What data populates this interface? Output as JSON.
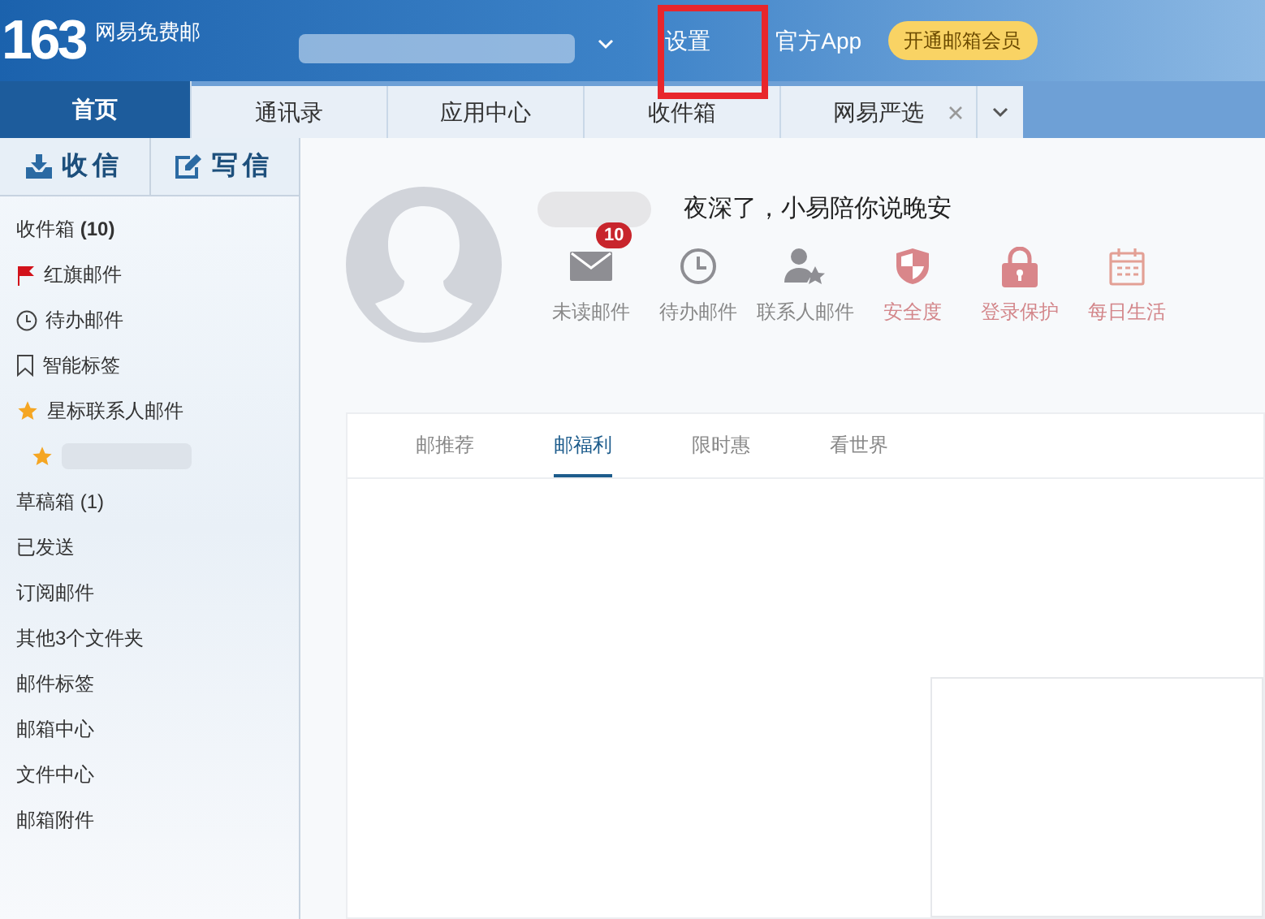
{
  "header": {
    "logo": "163",
    "brand": "网易免费邮",
    "links": [
      "设置",
      "官方App"
    ],
    "vip_button": "开通邮箱会员"
  },
  "tabs": [
    {
      "label": "首页",
      "selected": true,
      "closable": false
    },
    {
      "label": "通讯录",
      "selected": false,
      "closable": false
    },
    {
      "label": "应用中心",
      "selected": false,
      "closable": false
    },
    {
      "label": "收件箱",
      "selected": false,
      "closable": false
    },
    {
      "label": "网易严选",
      "selected": false,
      "closable": true
    }
  ],
  "sidebar": {
    "actions": [
      {
        "kind": "receive",
        "label": "收信"
      },
      {
        "kind": "compose",
        "label": "写信"
      }
    ],
    "items": [
      {
        "kind": "plain",
        "label": "收件箱 **(10)**"
      },
      {
        "kind": "flag",
        "label": "红旗邮件"
      },
      {
        "kind": "clock",
        "label": "待办邮件"
      },
      {
        "kind": "bookmark",
        "label": "智能标签"
      },
      {
        "kind": "star",
        "label": "星标联系人邮件"
      },
      {
        "kind": "redacted"
      },
      {
        "kind": "plain",
        "label": "草稿箱 (1)"
      },
      {
        "kind": "plain",
        "label": "已发送"
      },
      {
        "kind": "plain",
        "label": "订阅邮件"
      },
      {
        "kind": "plain",
        "label": "其他3个文件夹"
      },
      {
        "kind": "plain",
        "label": "邮件标签"
      },
      {
        "kind": "plain",
        "label": "邮箱中心"
      },
      {
        "kind": "plain",
        "label": "文件中心"
      },
      {
        "kind": "plain",
        "label": "邮箱附件"
      }
    ]
  },
  "greeting": "夜深了，小易陪你说晚安",
  "shortcuts": [
    {
      "kind": "mail",
      "label": "未读邮件",
      "badge": "10"
    },
    {
      "kind": "clock",
      "label": "待办邮件"
    },
    {
      "kind": "contact",
      "label": "联系人邮件"
    },
    {
      "kind": "shield",
      "label": "安全度"
    },
    {
      "kind": "lock",
      "label": "登录保护"
    },
    {
      "kind": "calendar",
      "label": "每日生活"
    }
  ],
  "content_tabs": [
    {
      "label": "邮推荐",
      "selected": false
    },
    {
      "label": "邮福利",
      "selected": true
    },
    {
      "label": "限时惠",
      "selected": false
    },
    {
      "label": "看世界",
      "selected": false
    }
  ]
}
